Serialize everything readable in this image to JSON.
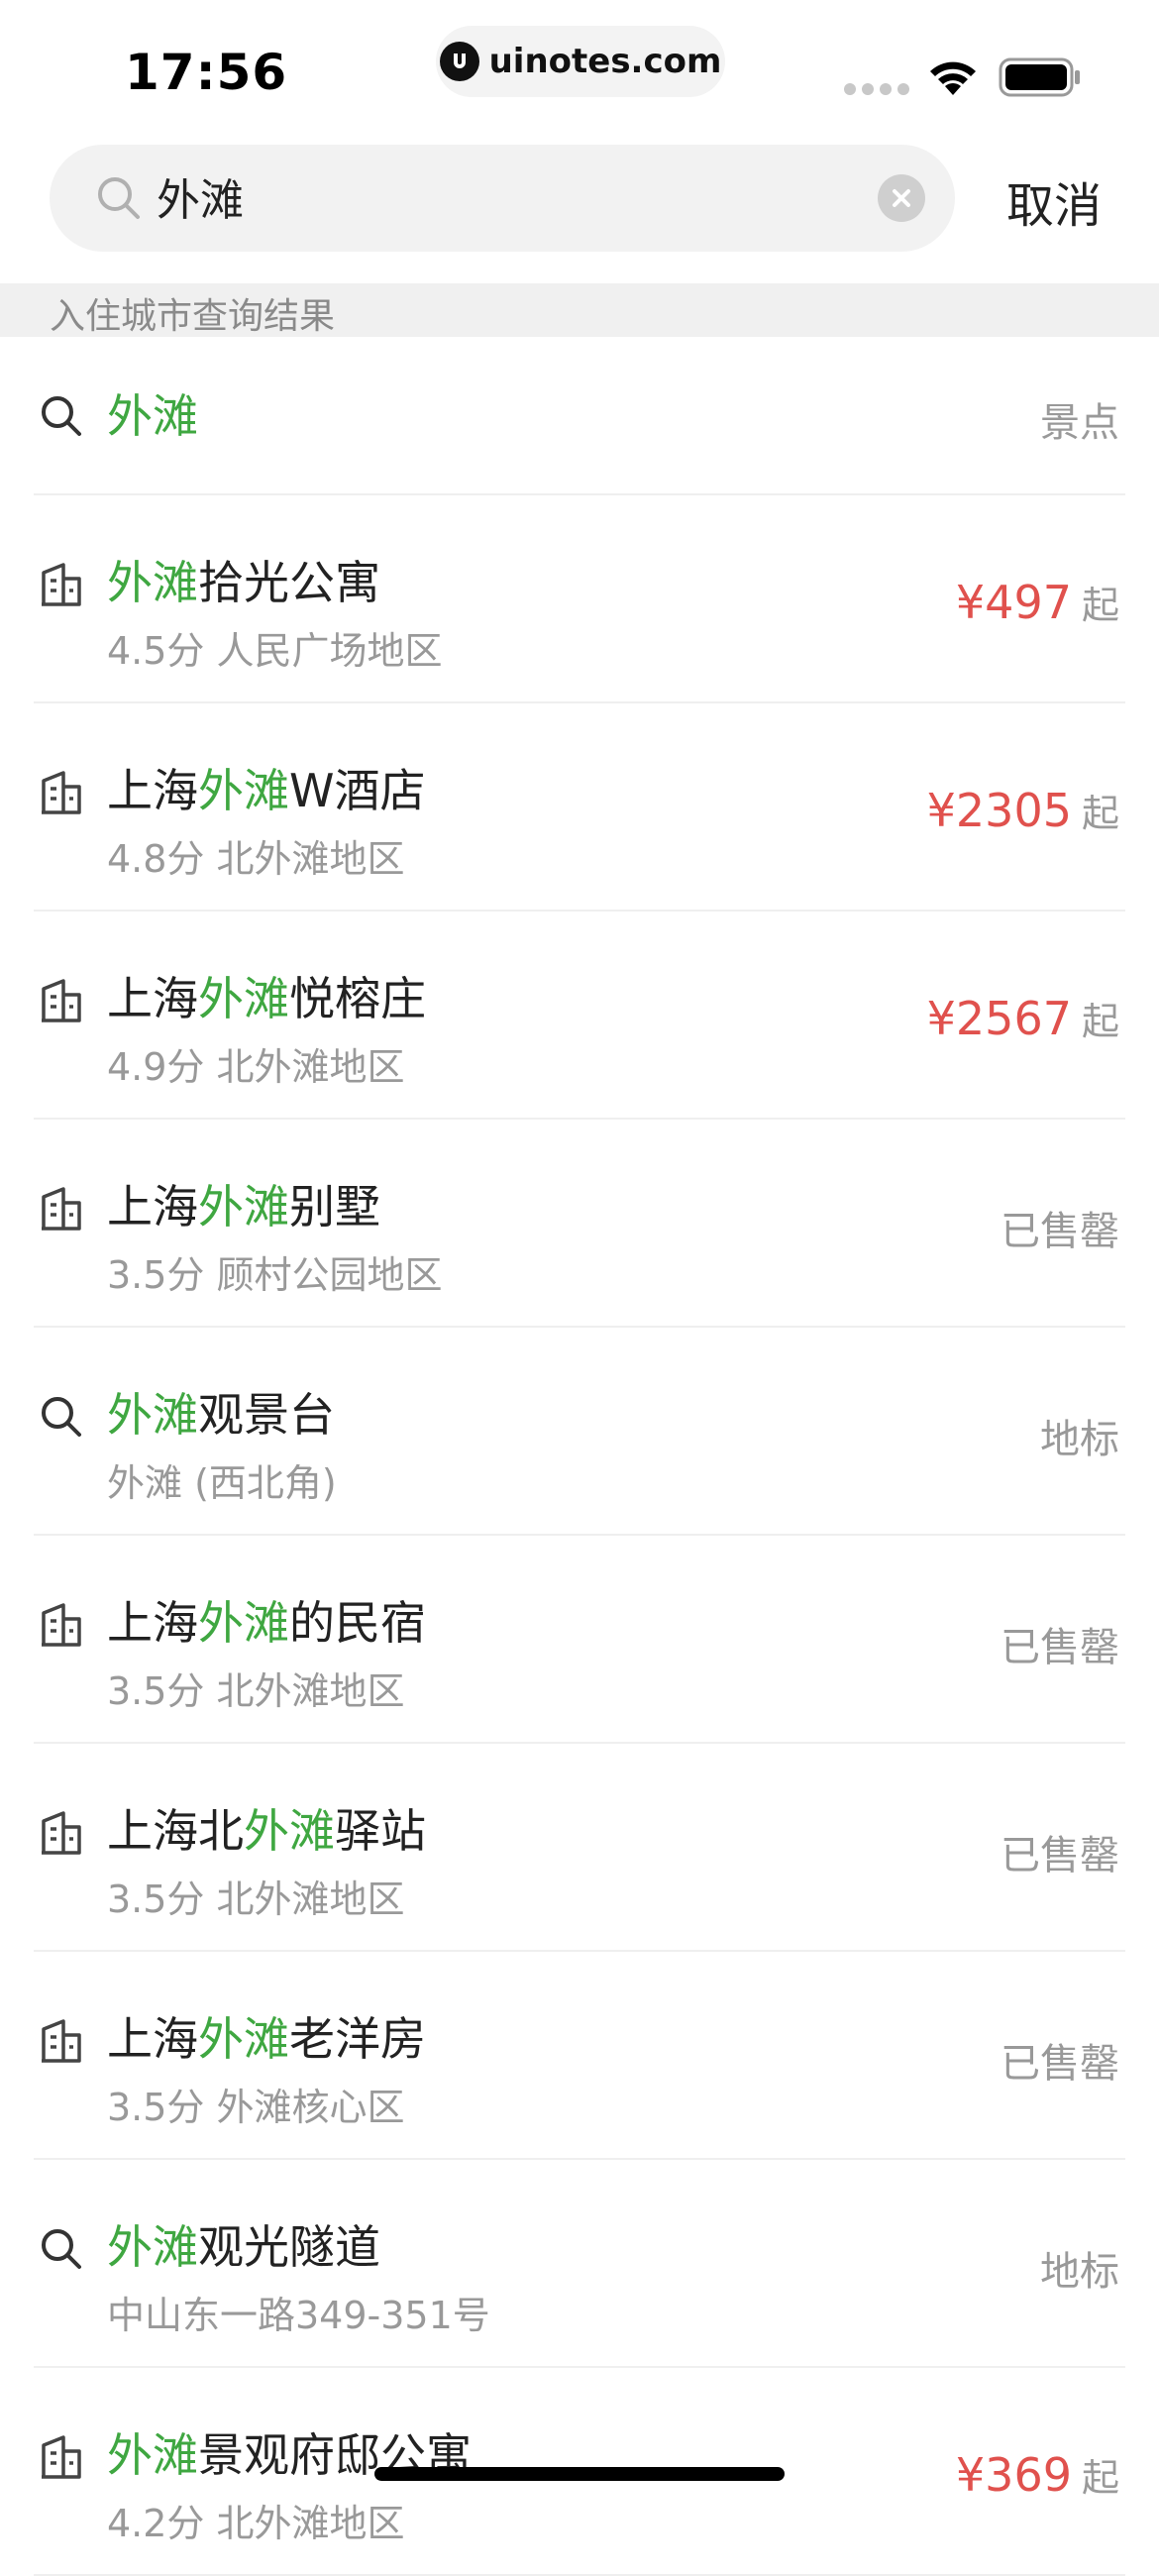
{
  "status_bar": {
    "time": "17:56",
    "url": "uinotes.com"
  },
  "search": {
    "query": "外滩",
    "cancel_label": "取消"
  },
  "section_header": "入住城市查询结果",
  "colors": {
    "highlight": "#3fa741",
    "price": "#e0514d"
  },
  "results": [
    {
      "icon": "search-icon",
      "title_pre": "",
      "title_hl": "外滩",
      "title_post": "",
      "subtitle": "",
      "right": "景点",
      "price": ""
    },
    {
      "icon": "hotel-icon",
      "title_pre": "",
      "title_hl": "外滩",
      "title_post": "拾光公寓",
      "subtitle": "4.5分  人民广场地区",
      "right": "",
      "price": "¥497",
      "price_suffix": "起"
    },
    {
      "icon": "hotel-icon",
      "title_pre": "上海",
      "title_hl": "外滩",
      "title_post": "W酒店",
      "subtitle": "4.8分  北外滩地区",
      "right": "",
      "price": "¥2305",
      "price_suffix": "起"
    },
    {
      "icon": "hotel-icon",
      "title_pre": "上海",
      "title_hl": "外滩",
      "title_post": "悦榕庄",
      "subtitle": "4.9分  北外滩地区",
      "right": "",
      "price": "¥2567",
      "price_suffix": "起"
    },
    {
      "icon": "hotel-icon",
      "title_pre": "上海",
      "title_hl": "外滩",
      "title_post": "别墅",
      "subtitle": "3.5分  顾村公园地区",
      "right": "已售罄",
      "price": ""
    },
    {
      "icon": "search-icon",
      "title_pre": "",
      "title_hl": "外滩",
      "title_post": "观景台",
      "subtitle": "外滩 (西北角)",
      "right": "地标",
      "price": ""
    },
    {
      "icon": "hotel-icon",
      "title_pre": "上海",
      "title_hl": "外滩",
      "title_post": "的民宿",
      "subtitle": "3.5分  北外滩地区",
      "right": "已售罄",
      "price": ""
    },
    {
      "icon": "hotel-icon",
      "title_pre": "上海北",
      "title_hl": "外滩",
      "title_post": "驿站",
      "subtitle": "3.5分  北外滩地区",
      "right": "已售罄",
      "price": ""
    },
    {
      "icon": "hotel-icon",
      "title_pre": "上海",
      "title_hl": "外滩",
      "title_post": "老洋房",
      "subtitle": "3.5分  外滩核心区",
      "right": "已售罄",
      "price": ""
    },
    {
      "icon": "search-icon",
      "title_pre": "",
      "title_hl": "外滩",
      "title_post": "观光隧道",
      "subtitle": "中山东一路349-351号",
      "right": "地标",
      "price": ""
    },
    {
      "icon": "hotel-icon",
      "title_pre": "",
      "title_hl": "外滩",
      "title_post": "景观府邸公寓",
      "subtitle": "4.2分  北外滩地区",
      "right": "",
      "price": "¥369",
      "price_suffix": "起"
    }
  ]
}
